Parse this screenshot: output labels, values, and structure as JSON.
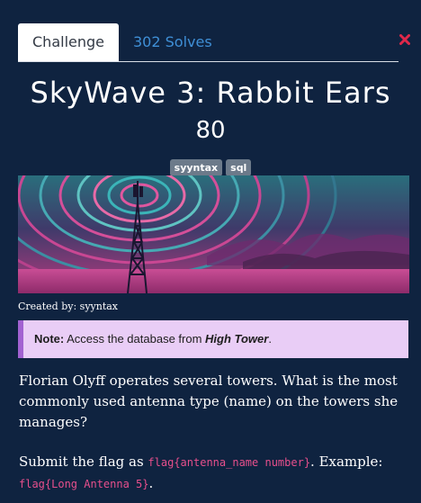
{
  "tabs": [
    {
      "label": "Challenge"
    },
    {
      "label": "302 Solves"
    }
  ],
  "challenge": {
    "title": "SkyWave 3: Rabbit Ears",
    "points": "80",
    "tags": [
      "syyntax",
      "sql"
    ],
    "created_by": "Created by: syyntax"
  },
  "note": {
    "label": "Note:",
    "text_before": " Access the database from ",
    "emphasis": "High Tower",
    "text_after": "."
  },
  "description": "Florian Olyff operates several towers. What is the most commonly used antenna type (name) on the towers she manages?",
  "submit": {
    "text_before": "Submit the flag as ",
    "flag_format": "flag{antenna_name number}",
    "text_middle": ". Example: ",
    "example": "flag{Long Antenna 5}",
    "text_after": "."
  },
  "icons": {
    "close": "close-icon"
  },
  "colors": {
    "background": "#0f2340",
    "tab_link": "#3f8fd6",
    "close": "#e0284a",
    "note_bg": "#e9cdf6",
    "note_border": "#a262d1",
    "code": "#e74f8c"
  }
}
